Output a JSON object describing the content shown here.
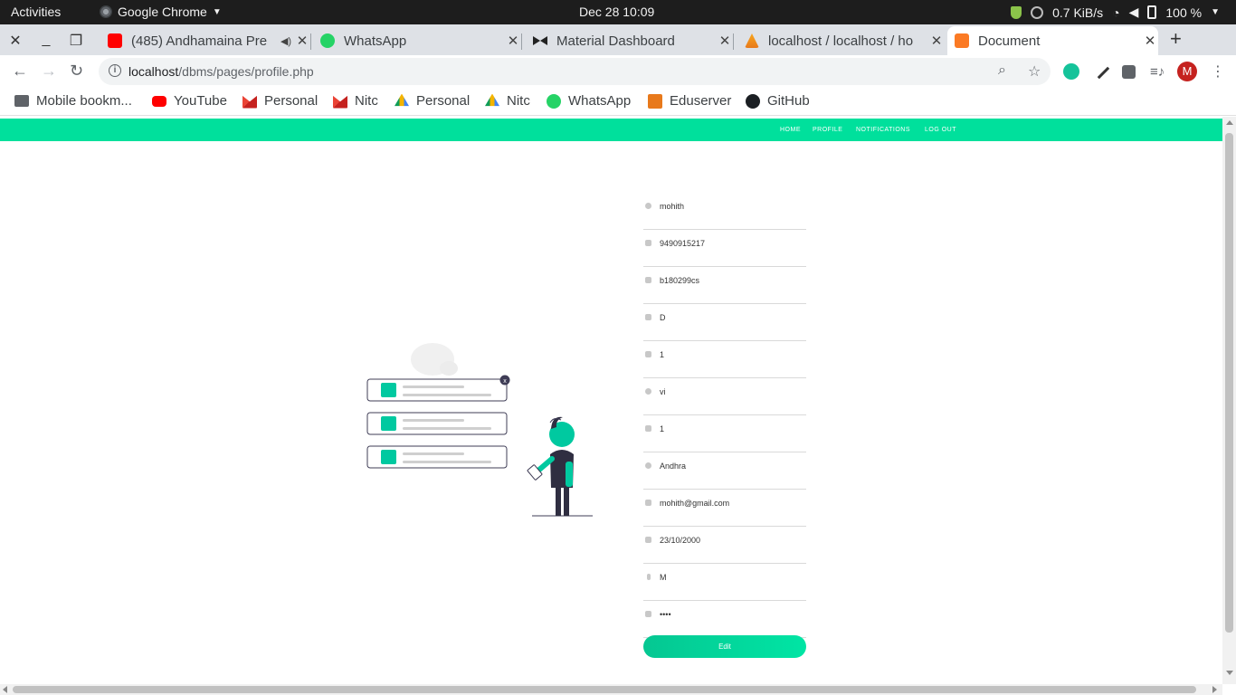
{
  "system": {
    "activities": "Activities",
    "app_name": "Google Chrome",
    "clock": "Dec 28  10:09",
    "net_speed": "0.7 KiB/s",
    "battery": "100 %"
  },
  "tabs": [
    {
      "title": "(485) Andhamaina Pre",
      "icon": "youtube-icon",
      "active": false
    },
    {
      "title": "WhatsApp",
      "icon": "whatsapp-icon",
      "active": false
    },
    {
      "title": "Material Dashboard",
      "icon": "material-dashboard-icon",
      "active": false
    },
    {
      "title": "localhost / localhost / ho",
      "icon": "phpmyadmin-icon",
      "active": false
    },
    {
      "title": "Document",
      "icon": "xampp-icon",
      "active": true
    }
  ],
  "address_bar": {
    "host": "localhost",
    "path": "/dbms/pages/profile.php"
  },
  "bookmarks": [
    {
      "label": "Mobile bookm...",
      "icon": "folder-icon"
    },
    {
      "label": "YouTube",
      "icon": "youtube-icon"
    },
    {
      "label": "Personal",
      "icon": "gmail-icon"
    },
    {
      "label": "Nitc",
      "icon": "gmail-icon"
    },
    {
      "label": "Personal",
      "icon": "google-drive-icon"
    },
    {
      "label": "Nitc",
      "icon": "google-drive-icon"
    },
    {
      "label": "WhatsApp",
      "icon": "whatsapp-icon"
    },
    {
      "label": "Eduserver",
      "icon": "moodle-icon"
    },
    {
      "label": "GitHub",
      "icon": "github-icon"
    }
  ],
  "page": {
    "accent_color": "#00e09c",
    "nav": [
      "HOME",
      "PROFILE",
      "NOTIFICATIONS",
      "LOG OUT"
    ],
    "fields": [
      {
        "icon": "user-icon",
        "value": "mohith",
        "type": "text"
      },
      {
        "icon": "phone-icon",
        "value": "9490915217",
        "type": "text"
      },
      {
        "icon": "id-card-icon",
        "value": "b180299cs",
        "type": "text"
      },
      {
        "icon": "building-icon",
        "value": "D",
        "type": "text"
      },
      {
        "icon": "credit-card-icon",
        "value": "1",
        "type": "text"
      },
      {
        "icon": "users-icon",
        "value": "vi",
        "type": "text"
      },
      {
        "icon": "credit-card-icon",
        "value": "1",
        "type": "text"
      },
      {
        "icon": "search-icon",
        "value": "Andhra",
        "type": "text"
      },
      {
        "icon": "envelope-icon",
        "value": "mohith@gmail.com",
        "type": "text"
      },
      {
        "icon": "calendar-icon",
        "value": "23/10/2000",
        "type": "text"
      },
      {
        "icon": "gender-icon",
        "value": "M",
        "type": "text"
      },
      {
        "icon": "lock-icon",
        "value": "••••",
        "type": "password"
      }
    ],
    "edit_label": "Edit"
  }
}
